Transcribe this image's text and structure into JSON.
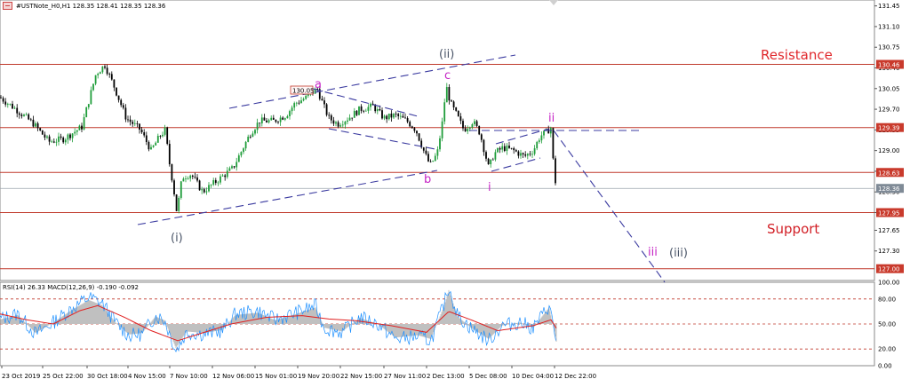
{
  "header": {
    "main_info": "#USTNote_H0,H1  128.35 128.41 128.35 128.36",
    "indicator_info": "RSI(14) 26.33 MACD(12,26,9) -0.190 -0.092"
  },
  "chart_data": [
    {
      "type": "line",
      "title": "#USTNote_H0,H1",
      "y_range": [
        126.8,
        131.55
      ],
      "price_axis_ticks": [
        "131.45",
        "131.10",
        "130.75",
        "130.40",
        "130.05",
        "129.70",
        "129.35",
        "129.00",
        "128.65",
        "128.30",
        "127.95",
        "127.65",
        "127.30"
      ],
      "x_tick_labels": [
        "23 Oct 2019",
        "25 Oct 22:00",
        "30 Oct 18:00",
        "4 Nov 15:00",
        "7 Nov 10:00",
        "12 Nov 06:00",
        "15 Nov 01:00",
        "19 Nov 20:00",
        "22 Nov 15:00",
        "27 Nov 11:00",
        "2 Dec 13:00",
        "5 Dec 08:00",
        "10 Dec 04:00",
        "12 Dec 22:00"
      ],
      "price_path": [
        [
          0,
          129.9
        ],
        [
          18,
          129.7
        ],
        [
          38,
          129.45
        ],
        [
          55,
          129.15
        ],
        [
          72,
          129.2
        ],
        [
          92,
          129.4
        ],
        [
          108,
          130.3
        ],
        [
          118,
          130.45
        ],
        [
          128,
          130.1
        ],
        [
          142,
          129.55
        ],
        [
          158,
          129.35
        ],
        [
          170,
          129.0
        ],
        [
          180,
          129.25
        ],
        [
          186,
          129.35
        ],
        [
          190,
          128.85
        ],
        [
          195,
          128.4
        ],
        [
          199,
          127.95
        ],
        [
          205,
          128.55
        ],
        [
          215,
          128.6
        ],
        [
          228,
          128.3
        ],
        [
          245,
          128.5
        ],
        [
          262,
          128.7
        ],
        [
          272,
          129.0
        ],
        [
          282,
          129.3
        ],
        [
          292,
          129.5
        ],
        [
          308,
          129.5
        ],
        [
          322,
          129.6
        ],
        [
          332,
          129.8
        ],
        [
          345,
          129.9
        ],
        [
          357,
          130.05
        ],
        [
          363,
          129.8
        ],
        [
          370,
          129.55
        ],
        [
          380,
          129.45
        ],
        [
          392,
          129.55
        ],
        [
          405,
          129.7
        ],
        [
          420,
          129.75
        ],
        [
          432,
          129.55
        ],
        [
          445,
          129.6
        ],
        [
          458,
          129.5
        ],
        [
          468,
          129.35
        ],
        [
          478,
          128.95
        ],
        [
          484,
          128.75
        ],
        [
          492,
          128.95
        ],
        [
          498,
          129.5
        ],
        [
          502,
          130.1
        ],
        [
          507,
          129.8
        ],
        [
          514,
          129.6
        ],
        [
          522,
          129.35
        ],
        [
          532,
          129.5
        ],
        [
          540,
          129.3
        ],
        [
          550,
          128.7
        ],
        [
          556,
          128.95
        ],
        [
          566,
          129.05
        ],
        [
          578,
          129.0
        ],
        [
          590,
          128.9
        ],
        [
          600,
          129.0
        ],
        [
          608,
          129.25
        ],
        [
          614,
          129.3
        ],
        [
          620,
          129.39
        ],
        [
          623,
          128.7
        ],
        [
          626,
          128.36
        ]
      ],
      "horizontal_levels": [
        130.46,
        129.39,
        128.63,
        128.36,
        127.95,
        127.0
      ],
      "level_labels": [
        "130.46",
        "129.39",
        "128.63",
        "128.36",
        "127.95",
        "127.00"
      ],
      "annotations": {
        "resistance": "Resistance",
        "support": "Support",
        "wave_i_minor": "(i)",
        "wave_ii_minor": "(ii)",
        "wave_iii_minor": "(iii)",
        "wave_a": "a",
        "wave_b": "b",
        "wave_c": "c",
        "wave_i": "i",
        "wave_ii": "ii",
        "wave_iii": "iii",
        "price_tag_a": "130.05"
      }
    },
    {
      "type": "line",
      "title": "RSI(14) 26.33 MACD(12,26,9) -0.190 -0.092",
      "y_range": [
        0,
        100
      ],
      "levels": [
        80,
        50,
        20
      ],
      "axis_ticks": [
        "100.00",
        "80.00",
        "50.00",
        "20.00",
        "0.00"
      ],
      "rsi_last": 26.33,
      "macd_main": -0.19,
      "macd_signal": -0.092,
      "series": [
        {
          "values": [
            [
              0,
              56
            ],
            [
              20,
              62
            ],
            [
              40,
              38
            ],
            [
              60,
              52
            ],
            [
              80,
              68
            ],
            [
              100,
              82
            ],
            [
              115,
              75
            ],
            [
              130,
              52
            ],
            [
              145,
              36
            ],
            [
              160,
              38
            ],
            [
              175,
              60
            ],
            [
              185,
              55
            ],
            [
              198,
              18
            ],
            [
              210,
              40
            ],
            [
              230,
              38
            ],
            [
              250,
              42
            ],
            [
              265,
              62
            ],
            [
              290,
              65
            ],
            [
              310,
              55
            ],
            [
              330,
              62
            ],
            [
              355,
              72
            ],
            [
              365,
              45
            ],
            [
              385,
              40
            ],
            [
              405,
              58
            ],
            [
              425,
              50
            ],
            [
              445,
              32
            ],
            [
              470,
              35
            ],
            [
              485,
              30
            ],
            [
              500,
              75
            ],
            [
              505,
              95
            ],
            [
              515,
              60
            ],
            [
              530,
              45
            ],
            [
              550,
              30
            ],
            [
              565,
              48
            ],
            [
              585,
              52
            ],
            [
              600,
              45
            ],
            [
              610,
              60
            ],
            [
              618,
              72
            ],
            [
              624,
              40
            ],
            [
              626,
              26.33
            ]
          ]
        },
        {
          "values": [
            [
              0,
              62
            ],
            [
              30,
              55
            ],
            [
              60,
              50
            ],
            [
              90,
              66
            ],
            [
              110,
              72
            ],
            [
              140,
              58
            ],
            [
              170,
              42
            ],
            [
              200,
              30
            ],
            [
              230,
              40
            ],
            [
              260,
              50
            ],
            [
              300,
              58
            ],
            [
              340,
              60
            ],
            [
              370,
              56
            ],
            [
              400,
              54
            ],
            [
              440,
              48
            ],
            [
              480,
              40
            ],
            [
              505,
              65
            ],
            [
              530,
              55
            ],
            [
              560,
              42
            ],
            [
              600,
              48
            ],
            [
              620,
              55
            ],
            [
              626,
              45
            ]
          ]
        }
      ]
    }
  ],
  "colors": {
    "background": "#ffffff",
    "grid": "#d8d8d8",
    "level_line": "#c0392b",
    "current_line": "#9aa3ad",
    "trend_dash": "#3b3ba0",
    "candle_up": "#1f9d3a",
    "candle_down": "#000000",
    "resistance_text": "#e0282c",
    "support_text": "#d21f26",
    "wave_minor": "#4a5568",
    "wave_magenta": "#c626c6",
    "rsi": "#1e90ff",
    "signal": "#e02020",
    "histogram": "#c0c0c0",
    "level_label_bg": "#c93a2c",
    "current_label_bg": "#7f8a96"
  }
}
